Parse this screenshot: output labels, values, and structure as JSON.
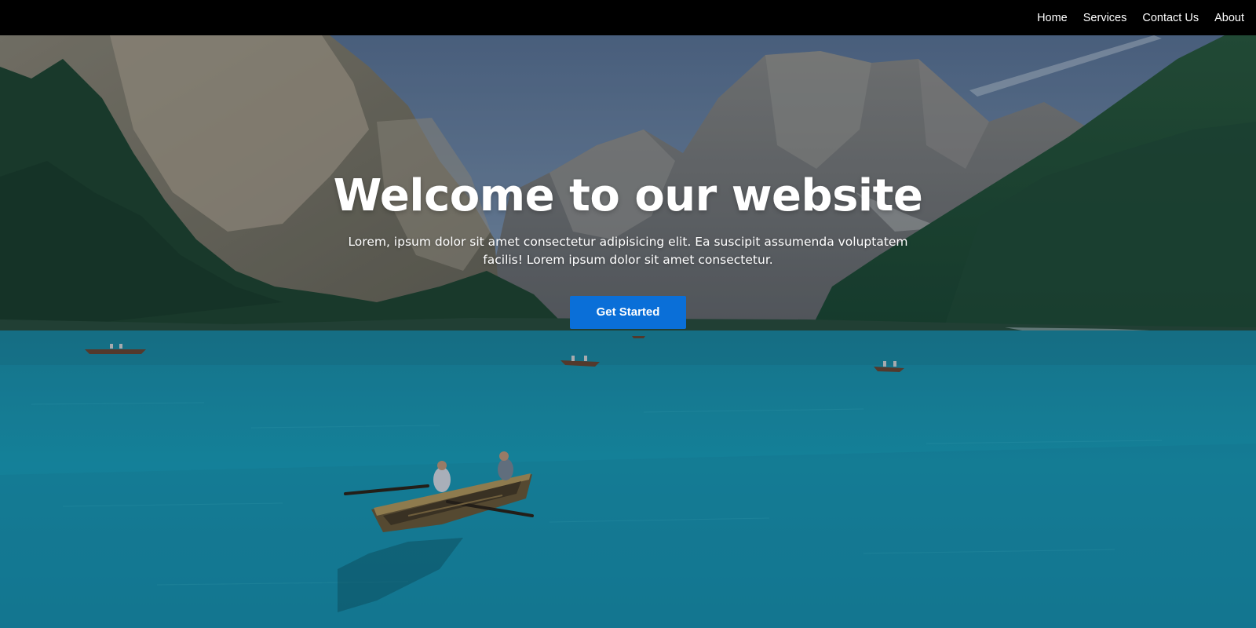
{
  "nav": {
    "links": [
      {
        "label": "Home"
      },
      {
        "label": "Services"
      },
      {
        "label": "Contact Us"
      },
      {
        "label": "About"
      }
    ]
  },
  "hero": {
    "title": "Welcome to our website",
    "subtitle": "Lorem, ipsum dolor sit amet consectetur adipisicing elit. Ea suscipit assumenda voluptatem facilis! Lorem ipsum dolor sit amet consectetur.",
    "cta_label": "Get Started",
    "background_image": "mountain-lake-with-rowboats-photo"
  },
  "colors": {
    "navbar_bg": "#000000",
    "nav_text": "#ffffff",
    "cta_bg": "#0a6fd8",
    "cta_text": "#ffffff",
    "hero_text": "#ffffff"
  }
}
